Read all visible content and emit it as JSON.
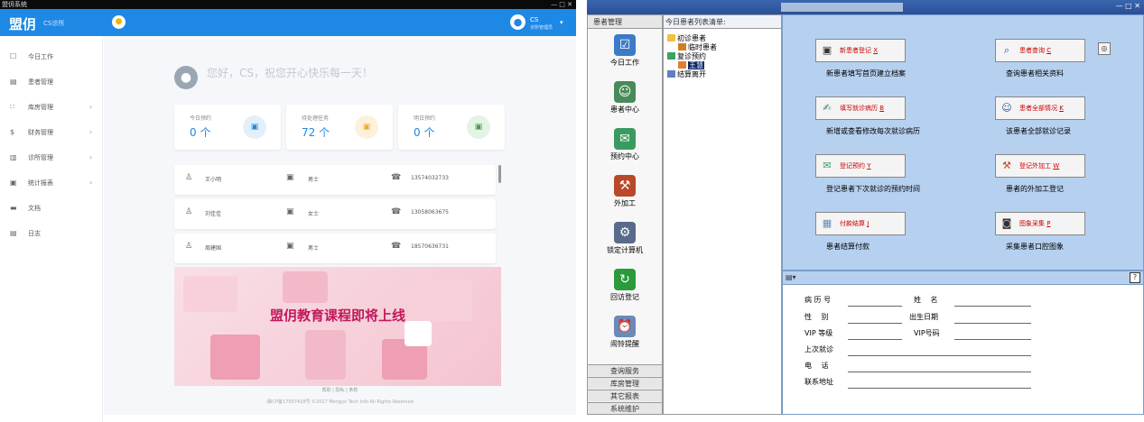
{
  "left_app": {
    "window_title": "盟仴系统",
    "logo": "盟仴",
    "logo_sub": "CS诊所",
    "user": {
      "name": "CS",
      "role": "诊所管理员"
    },
    "sidebar": [
      {
        "icon": "☐",
        "label": "今日工作",
        "chevron": ""
      },
      {
        "icon": "▤",
        "label": "患者管理",
        "chevron": ""
      },
      {
        "icon": "∷",
        "label": "库房管理",
        "chevron": "›"
      },
      {
        "icon": "$",
        "label": "财务管理",
        "chevron": "›"
      },
      {
        "icon": "▥",
        "label": "诊所管理",
        "chevron": "›"
      },
      {
        "icon": "▣",
        "label": "统计报表",
        "chevron": "›"
      },
      {
        "icon": "▬",
        "label": "文档",
        "chevron": ""
      },
      {
        "icon": "▤",
        "label": "日志",
        "chevron": ""
      }
    ],
    "greeting": "您好，CS，祝您开心快乐每一天！",
    "stats": [
      {
        "label": "今日预约",
        "value": "0 个",
        "color": "#1e88e5",
        "bg": "#e3f0fb"
      },
      {
        "label": "待处理任务",
        "value": "72 个",
        "color": "#f9a825",
        "bg": "#fdf1dc"
      },
      {
        "label": "明日预约",
        "value": "0 个",
        "color": "#43a047",
        "bg": "#e3f3e4"
      }
    ],
    "patients": [
      {
        "name": "王小明",
        "gender": "男士",
        "phone": "13574032733"
      },
      {
        "name": "刘佳佳",
        "gender": "女士",
        "phone": "13058063675"
      },
      {
        "name": "周建国",
        "gender": "男士",
        "phone": "18570636731"
      }
    ],
    "banner_text": "盟仴教育课程即将上线",
    "footer_links": "帮助   |   隐私   |   条款",
    "footer_copy": "湘ICP备17007418号 ©2017 Mengyo Tech Info All Rights Reserved"
  },
  "right_app": {
    "nav_header": "患者管理",
    "nav_items": [
      {
        "label": "今日工作",
        "icon": "☑",
        "color": "#3b7bc8"
      },
      {
        "label": "患者中心",
        "icon": "☺",
        "color": "#4a8a5a"
      },
      {
        "label": "预约中心",
        "icon": "✉",
        "color": "#3a9a60"
      },
      {
        "label": "外加工",
        "icon": "⚒",
        "color": "#b84a2a"
      },
      {
        "label": "锁定计算机",
        "icon": "⚙",
        "color": "#5a6a8a"
      },
      {
        "label": "回访登记",
        "icon": "↻",
        "color": "#2a9a3a"
      },
      {
        "label": "闹铃提醒",
        "icon": "⏰",
        "color": "#6a8ab8"
      }
    ],
    "nav_bottom": [
      "查询服务",
      "库房管理",
      "其它报表",
      "系统维护"
    ],
    "tree_header": "今日患者列表清单:",
    "tree": [
      {
        "label": "初诊患者",
        "level": 0
      },
      {
        "label": "临时患者",
        "level": 1
      },
      {
        "label": "复诊预约",
        "level": 0
      },
      {
        "label": "王慧",
        "level": 1
      },
      {
        "label": "结算离开",
        "level": 0
      }
    ],
    "functions": [
      {
        "label": "新患者登记",
        "key": "X",
        "icon": "▣",
        "desc": "新患者填写首页建立档案"
      },
      {
        "label": "患者查询",
        "key": "C",
        "icon": "⌕",
        "desc": "查询患者相关资料"
      },
      {
        "label": "填写就诊病历",
        "key": "B",
        "icon": "✍",
        "desc": "新增或查看修改每次就诊病历"
      },
      {
        "label": "患者全部情况",
        "key": "K",
        "icon": "☺",
        "desc": "该患者全部就诊记录"
      },
      {
        "label": "登记预约",
        "key": "Y",
        "icon": "✉",
        "desc": "登记患者下次就诊的预约时间"
      },
      {
        "label": "登记外加工",
        "key": "W",
        "icon": "⚒",
        "desc": "患者的外加工登记"
      },
      {
        "label": "付款结算",
        "key": "J",
        "icon": "▦",
        "desc": "患者结算付款"
      },
      {
        "label": "图象采集",
        "key": "P",
        "icon": "◙",
        "desc": "采集患者口腔图象"
      }
    ],
    "info_fields": {
      "record_no": "病 历 号",
      "name": "姓　 名",
      "gender": "性　 别",
      "birth": "出生日期",
      "vip_level": "VIP 等级",
      "vip_no": "VIP号码",
      "last_visit": "上次就诊",
      "phone": "电　 话",
      "address": "联系地址"
    },
    "help": "?"
  }
}
